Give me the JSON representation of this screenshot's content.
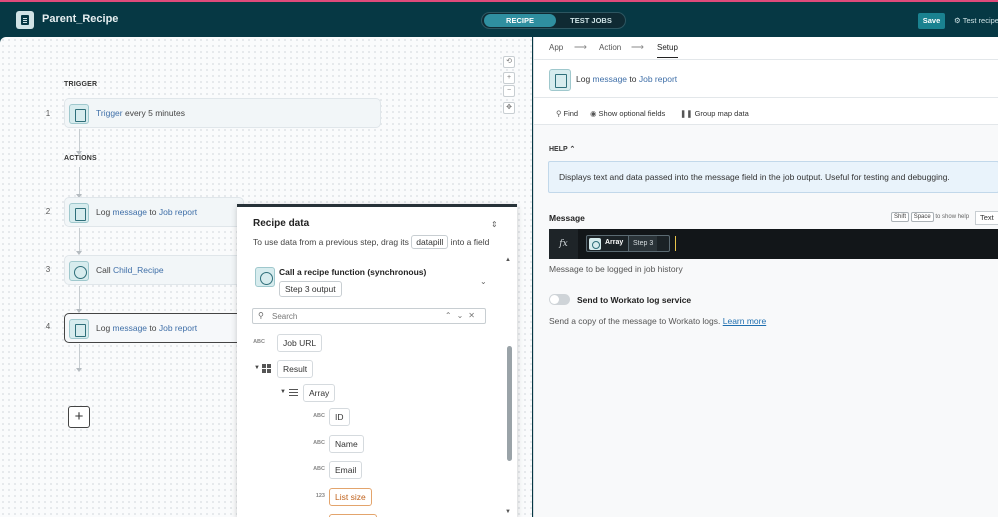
{
  "header": {
    "title": "Parent_Recipe",
    "tabs": [
      "RECIPE",
      "TEST JOBS"
    ],
    "save_label": "Save",
    "test_label": "Test recipe"
  },
  "canvas": {
    "trigger_label": "TRIGGER",
    "actions_label": "ACTIONS",
    "steps": [
      {
        "num": "1",
        "pre": "Trigger",
        "mid": " every 5 minutes",
        "post": "",
        "end": ""
      },
      {
        "num": "2",
        "pre": "Log ",
        "mid": "message",
        "post": " to ",
        "end": "Job report"
      },
      {
        "num": "3",
        "pre": "Call ",
        "mid": "Child_Recipe",
        "post": "",
        "end": ""
      },
      {
        "num": "4",
        "pre": "Log ",
        "mid": "message",
        "post": " to ",
        "end": "Job report"
      }
    ],
    "add_label": "+"
  },
  "recipe_data": {
    "title": "Recipe data",
    "subtitle_pre": "To use data from a previous step, drag its",
    "subtitle_chip": "datapill",
    "subtitle_post": "into a field",
    "step_title": "Call a recipe function (synchronous)",
    "step_output": "Step 3 output",
    "search_placeholder": "Search",
    "fields": [
      {
        "type": "ABC",
        "label": "Job URL"
      },
      {
        "type": "",
        "label": "Result"
      },
      {
        "type": "",
        "label": "Array"
      },
      {
        "type": "ABC",
        "label": "ID"
      },
      {
        "type": "ABC",
        "label": "Name"
      },
      {
        "type": "ABC",
        "label": "Email"
      },
      {
        "type": "123",
        "label": "List size"
      }
    ]
  },
  "right": {
    "crumbs": [
      "App",
      "Action",
      "Setup"
    ],
    "title_pre": "Log ",
    "title_k1": "message",
    "title_mid": " to ",
    "title_k2": "Job report",
    "tools": [
      "Find",
      "Show optional fields",
      "Group map data"
    ],
    "help_label": "HELP",
    "help_text": "Displays text and data passed into the message field in the job output. Useful for testing and debugging.",
    "message_label": "Message",
    "kbd_shift": "Shift",
    "kbd_space": "Space",
    "kbd_hint": "to show help",
    "text_mode": "Text",
    "pill_name": "Array",
    "pill_step": "Step 3",
    "message_hint": "Message to be logged in job history",
    "toggle_label": "Send to Workato log service",
    "toggle_desc": "Send a copy of the message to Workato logs.",
    "learn_more": "Learn more",
    "toggle_on": false
  },
  "colors": {
    "brand_dark": "#063844",
    "accent": "#1a8290",
    "datapill_link": "#3f6fa8",
    "orange_type": "#c0621c"
  }
}
